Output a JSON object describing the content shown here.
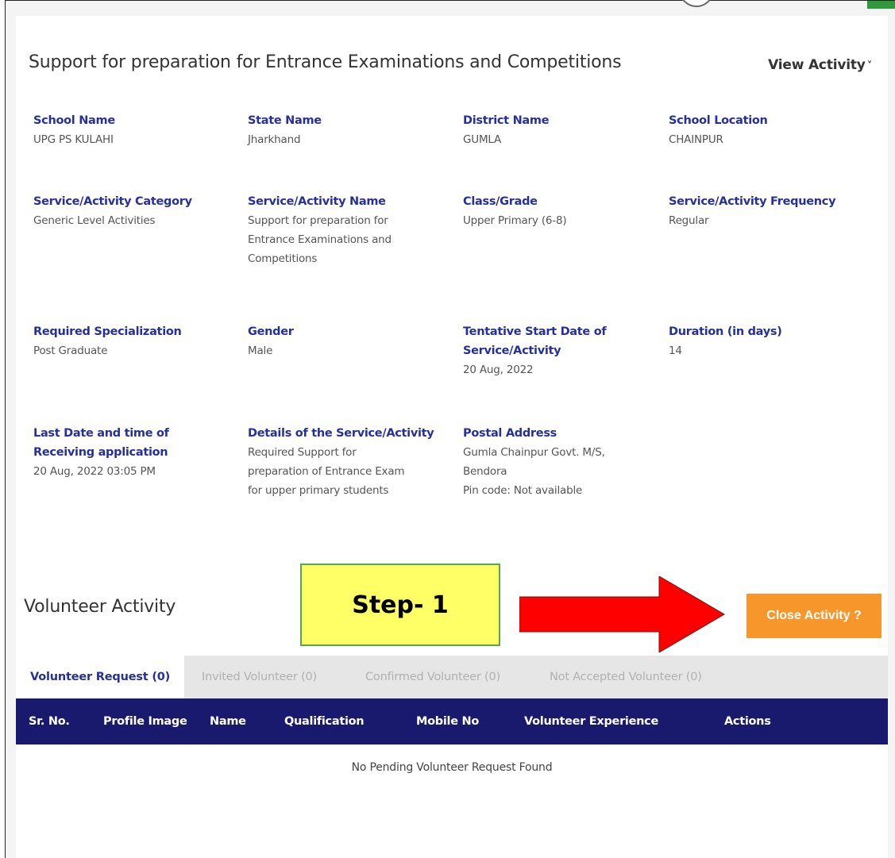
{
  "activity": {
    "title": "Support for preparation for Entrance Examinations and Competitions",
    "view_label": "View Activity",
    "fields": [
      {
        "label": "School Name",
        "value": "UPG PS KULAHI"
      },
      {
        "label": "State Name",
        "value": "Jharkhand"
      },
      {
        "label": "District Name",
        "value": "GUMLA"
      },
      {
        "label": "School Location",
        "value": "CHAINPUR"
      },
      {
        "label": "Service/Activity Category",
        "value": "Generic Level Activities"
      },
      {
        "label": "Service/Activity Name",
        "value": "Support for preparation for\nEntrance Examinations and\nCompetitions"
      },
      {
        "label": "Class/Grade",
        "value": "Upper Primary (6-8)"
      },
      {
        "label": "Service/Activity Frequency",
        "value": "Regular"
      },
      {
        "label": "Required Specialization",
        "value": "Post Graduate"
      },
      {
        "label": "Gender",
        "value": "Male"
      },
      {
        "label": "Tentative Start Date of\nService/Activity",
        "value": "20 Aug, 2022"
      },
      {
        "label": "Duration (in days)",
        "value": "14"
      },
      {
        "label": "Last Date and time of\nReceiving application",
        "value": "20 Aug, 2022 03:05 PM"
      },
      {
        "label": "Details of the Service/Activity",
        "value": "Required Support for\npreparation of Entrance Exam\nfor upper primary students"
      },
      {
        "label": "Postal Address",
        "value": "Gumla Chainpur Govt. M/S,\nBendora\nPin code: Not available"
      }
    ]
  },
  "volunteer": {
    "title": "Volunteer Activity",
    "step_label": "Step- 1",
    "close_label": "Close Activity ?",
    "tabs": [
      "Volunteer Request (0)",
      "Invited Volunteer (0)",
      "Confirmed Volunteer (0)",
      "Not Accepted Volunteer (0)"
    ],
    "columns": [
      "Sr. No.",
      "Profile Image",
      "Name",
      "Qualification",
      "Mobile No",
      "Volunteer Experience",
      "Actions"
    ],
    "empty_message": "No Pending Volunteer Request Found"
  },
  "colors": {
    "label": "#26309a",
    "table_header": "#19196e",
    "close_button": "#f7962b",
    "step_box": "#ffff66",
    "arrow": "#ff0000"
  },
  "icons": {
    "view_toggle": "chevron-down-icon",
    "annotation": "right-arrow-icon"
  }
}
